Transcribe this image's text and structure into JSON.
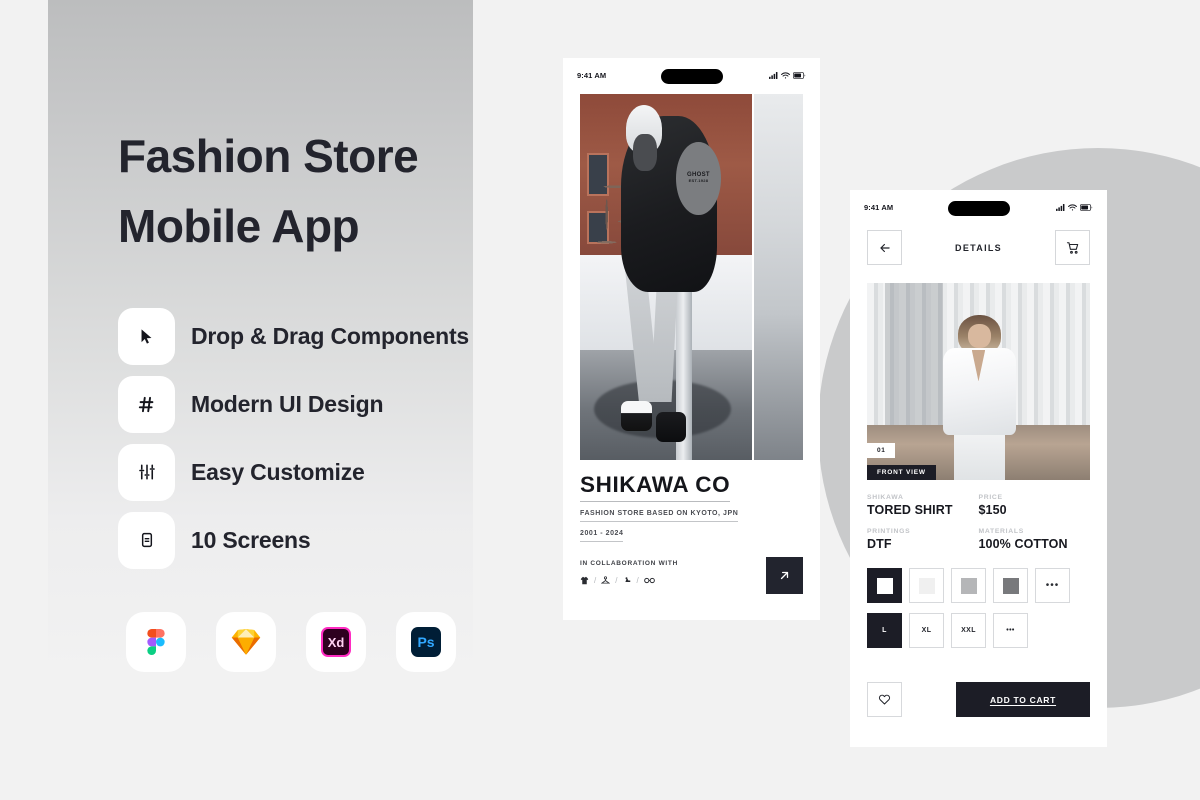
{
  "page": {
    "background_color": "#f2f2f2",
    "accent_dark": "#1c1d26",
    "panel_gradient_top": "#bcbdbe",
    "panel_gradient_bottom": "#f2f2f2"
  },
  "left_panel": {
    "headline_line1": "Fashion Store",
    "headline_line2": "Mobile App",
    "features": [
      {
        "icon": "cursor-icon",
        "label": "Drop & Drag Components"
      },
      {
        "icon": "hash-icon",
        "label": "Modern UI Design"
      },
      {
        "icon": "sliders-icon",
        "label": "Easy Customize"
      },
      {
        "icon": "phone-icon",
        "label": "10 Screens"
      }
    ],
    "logos": [
      {
        "name": "figma-logo",
        "label": "Figma"
      },
      {
        "name": "sketch-logo",
        "label": "Sketch"
      },
      {
        "name": "adobe-xd-logo",
        "label": "Xd"
      },
      {
        "name": "photoshop-logo",
        "label": "Ps"
      }
    ]
  },
  "phone_one": {
    "status_bar": {
      "time": "9:41 AM",
      "icons": [
        "cellular-signal-icon",
        "wifi-icon",
        "battery-icon"
      ]
    },
    "hero": {
      "graphic_text_line1": "GHOST",
      "graphic_text_line2": "EST.1928"
    },
    "brand_name": "SHIKAWA CO",
    "brand_subtitle": "FASHION STORE BASED ON KYOTO, JPN",
    "brand_years": "2001 - 2024",
    "collaboration_label": "IN COLLABORATION WITH",
    "collaboration_icons": [
      "tshirt-icon",
      "hanger-icon",
      "shoe-icon",
      "glasses-icon"
    ],
    "separator": "/",
    "arrow_button": "arrow-up-right-icon"
  },
  "phone_two": {
    "status_bar": {
      "time": "9:41 AM",
      "icons": [
        "cellular-signal-icon",
        "wifi-icon",
        "battery-icon"
      ]
    },
    "nav": {
      "back_icon": "arrow-left-icon",
      "title": "DETAILS",
      "cart_icon": "shopping-cart-icon"
    },
    "photo": {
      "index_badge": "01",
      "view_badge": "FRONT VIEW"
    },
    "specs": [
      {
        "key": "SHIKAWA",
        "value": "TORED SHIRT"
      },
      {
        "key": "PRICE",
        "value": "$150"
      },
      {
        "key": "PRINTINGS",
        "value": "DTF"
      },
      {
        "key": "MATERIALS",
        "value": "100% COTTON"
      }
    ],
    "colors": {
      "options": [
        {
          "name": "white-on-black",
          "chip": "#ffffff",
          "selected": true
        },
        {
          "name": "off-white",
          "chip": "#f0f0f0",
          "selected": false
        },
        {
          "name": "light-gray",
          "chip": "#b5b6b8",
          "selected": false
        },
        {
          "name": "dark-gray",
          "chip": "#78797c",
          "selected": false
        }
      ],
      "more_label": "•••"
    },
    "sizes": {
      "options": [
        {
          "label": "L",
          "selected": true
        },
        {
          "label": "XL",
          "selected": false
        },
        {
          "label": "XXL",
          "selected": false
        }
      ],
      "more_label": "•••"
    },
    "wishlist_icon": "heart-icon",
    "add_to_cart_label": "ADD TO CART"
  }
}
